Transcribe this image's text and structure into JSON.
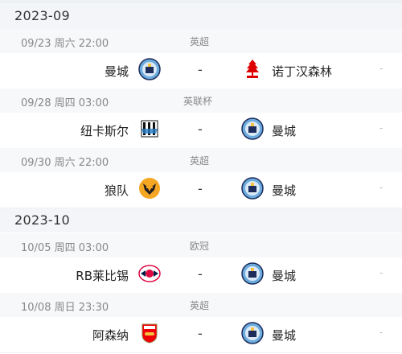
{
  "months": [
    {
      "label": "2023-09",
      "matches": [
        {
          "datetime": "09/23  周六 22:00",
          "league": "英超",
          "home": {
            "name": "曼城",
            "crest": "man-city-crest"
          },
          "away": {
            "name": "诺丁汉森林",
            "crest": "nottingham-forest-crest"
          },
          "vs": "-",
          "extra": "-"
        },
        {
          "datetime": "09/28  周四 03:00",
          "league": "英联杯",
          "home": {
            "name": "纽卡斯尔",
            "crest": "newcastle-crest"
          },
          "away": {
            "name": "曼城",
            "crest": "man-city-crest"
          },
          "vs": "-",
          "extra": "-"
        },
        {
          "datetime": "09/30  周六 22:00",
          "league": "英超",
          "home": {
            "name": "狼队",
            "crest": "wolves-crest"
          },
          "away": {
            "name": "曼城",
            "crest": "man-city-crest"
          },
          "vs": "-",
          "extra": "-"
        }
      ]
    },
    {
      "label": "2023-10",
      "matches": [
        {
          "datetime": "10/05  周四 03:00",
          "league": "欧冠",
          "home": {
            "name": "RB莱比锡",
            "crest": "rb-leipzig-crest"
          },
          "away": {
            "name": "曼城",
            "crest": "man-city-crest"
          },
          "vs": "-",
          "extra": "-"
        },
        {
          "datetime": "10/08  周日 23:30",
          "league": "英超",
          "home": {
            "name": "阿森纳",
            "crest": "arsenal-crest"
          },
          "away": {
            "name": "曼城",
            "crest": "man-city-crest"
          },
          "vs": "-",
          "extra": "-"
        }
      ]
    }
  ]
}
